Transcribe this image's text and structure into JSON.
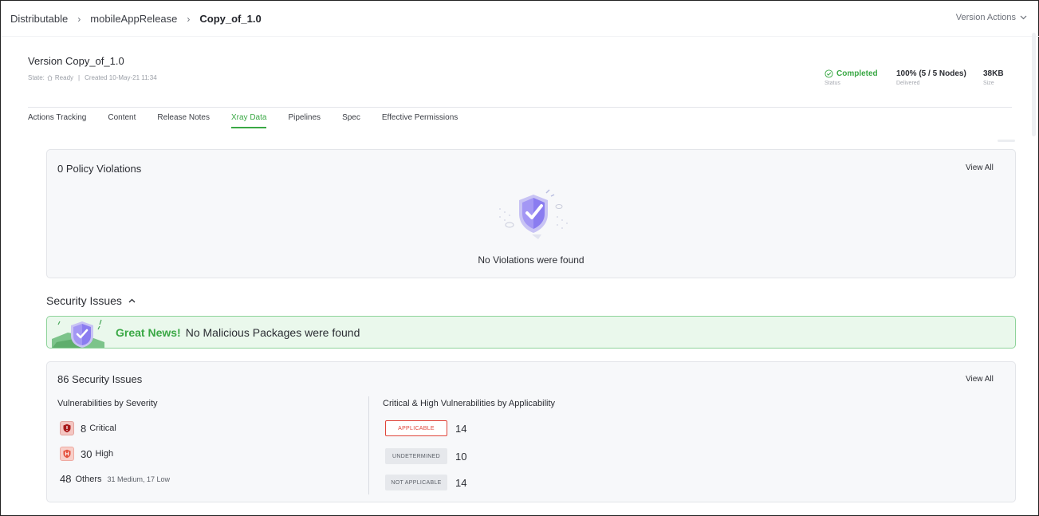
{
  "breadcrumb": {
    "items": [
      "Distributable",
      "mobileAppRelease",
      "Copy_of_1.0"
    ],
    "separator": "›"
  },
  "version_actions": {
    "label": "Version Actions"
  },
  "header": {
    "title": "Version Copy_of_1.0",
    "state_label": "State:",
    "state_value": "Ready",
    "meta_sep": "|",
    "created": "Created 10-May-21 11:34",
    "stats": [
      {
        "value": "Completed",
        "label": "Status"
      },
      {
        "value": "100% (5 / 5 Nodes)",
        "label": "Delivered"
      },
      {
        "value": "38KB",
        "label": "Size"
      }
    ]
  },
  "tabs": [
    {
      "label": "Actions Tracking",
      "active": false
    },
    {
      "label": "Content",
      "active": false
    },
    {
      "label": "Release Notes",
      "active": false
    },
    {
      "label": "Xray Data",
      "active": true
    },
    {
      "label": "Pipelines",
      "active": false
    },
    {
      "label": "Spec",
      "active": false
    },
    {
      "label": "Effective Permissions",
      "active": false
    }
  ],
  "policy_violations": {
    "title": "0 Policy Violations",
    "view_all": "View All",
    "message": "No Violations were found"
  },
  "security_section": {
    "title": "Security Issues"
  },
  "great_news": {
    "headline": "Great News!",
    "message": "No Malicious Packages were found"
  },
  "security_issues": {
    "title": "86 Security Issues",
    "view_all": "View All",
    "severity": {
      "title": "Vulnerabilities by Severity",
      "critical": {
        "count": "8",
        "label": "Critical"
      },
      "high": {
        "count": "30",
        "label": "High"
      },
      "others": {
        "count": "48",
        "label": "Others",
        "detail": "31 Medium, 17 Low"
      }
    },
    "applicability": {
      "title": "Critical & High Vulnerabilities by Applicability",
      "rows": [
        {
          "label": "APPLICABLE",
          "count": "14"
        },
        {
          "label": "UNDETERMINED",
          "count": "10"
        },
        {
          "label": "NOT APPLICABLE",
          "count": "14"
        }
      ]
    }
  },
  "colors": {
    "accent_green": "#3aa845",
    "critical_red": "#c0392b",
    "high_red": "#e74c3c",
    "applicable_red": "#e0453a",
    "shield_purple": "#7b68ee"
  }
}
